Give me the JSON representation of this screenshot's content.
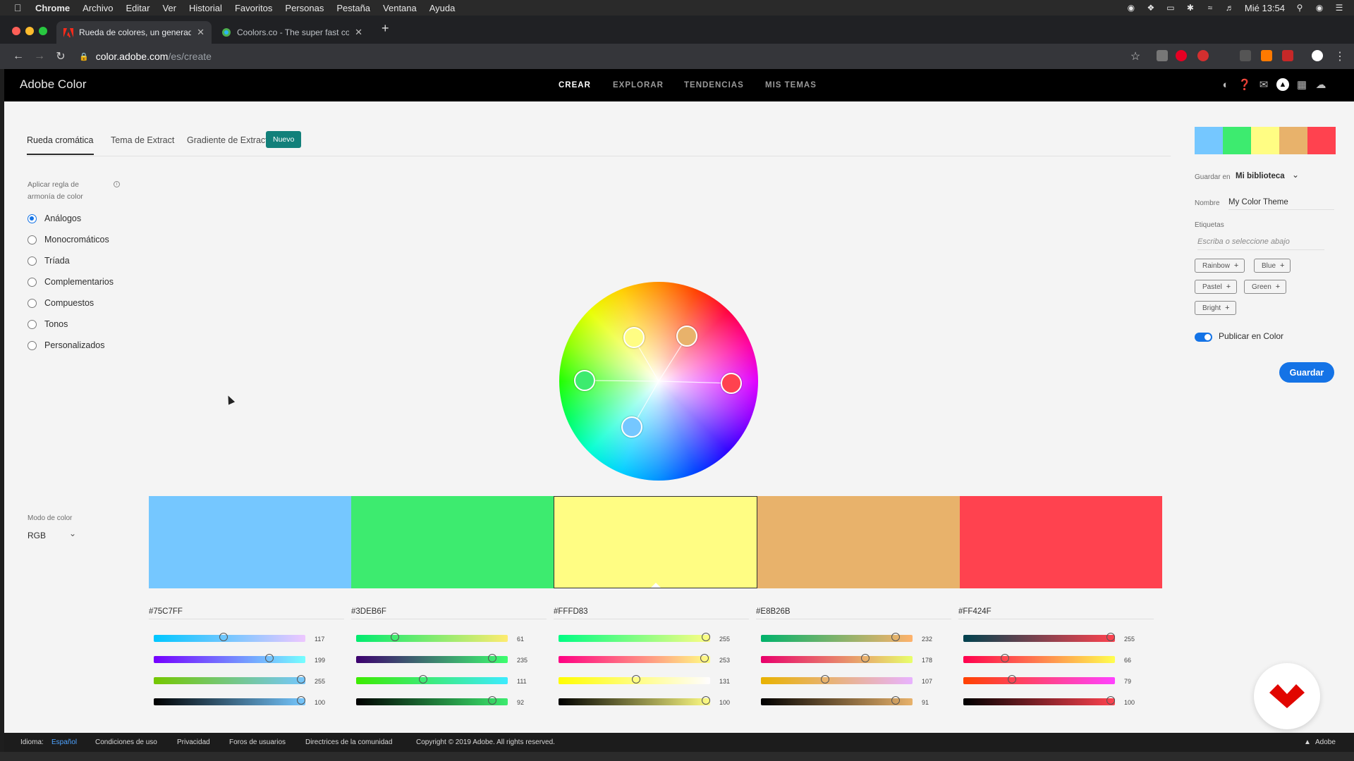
{
  "os_menubar": {
    "app": "Chrome",
    "items": [
      "Archivo",
      "Editar",
      "Ver",
      "Historial",
      "Favoritos",
      "Personas",
      "Pestaña",
      "Ventana",
      "Ayuda"
    ],
    "clock": "Mié 13:54"
  },
  "browser": {
    "tabs": [
      {
        "title": "Rueda de colores, un generador",
        "active": true
      },
      {
        "title": "Coolors.co - The super fast co",
        "active": false
      }
    ],
    "url_host": "color.adobe.com",
    "url_path": "/es/create"
  },
  "app": {
    "logo": "Adobe Color",
    "nav": [
      "CREAR",
      "EXPLORAR",
      "TENDENCIAS",
      "MIS TEMAS"
    ]
  },
  "mode_tabs": {
    "items": [
      "Rueda cromática",
      "Tema de Extract",
      "Gradiente de Extract"
    ],
    "badge": "Nuevo"
  },
  "harmony": {
    "label": "Aplicar regla de armonía de color",
    "options": [
      "Análogos",
      "Monocromáticos",
      "Tríada",
      "Complementarios",
      "Compuestos",
      "Tonos",
      "Personalizados"
    ],
    "selected": "Análogos"
  },
  "color_mode": {
    "label": "Modo de color",
    "value": "RGB"
  },
  "palette": [
    {
      "hex": "#75C7FF",
      "values": [
        "117",
        "199",
        "255",
        "100"
      ],
      "levels": [
        0.46,
        0.78,
        1.0,
        1.0
      ]
    },
    {
      "hex": "#3DEB6F",
      "values": [
        "61",
        "235",
        "111",
        "92"
      ],
      "levels": [
        0.24,
        0.92,
        0.44,
        0.92
      ]
    },
    {
      "hex": "#FFFD83",
      "values": [
        "255",
        "253",
        "131",
        "100"
      ],
      "levels": [
        1.0,
        0.99,
        0.51,
        1.0
      ]
    },
    {
      "hex": "#E8B26B",
      "values": [
        "232",
        "178",
        "107",
        "91"
      ],
      "levels": [
        0.91,
        0.7,
        0.42,
        0.91
      ]
    },
    {
      "hex": "#FF424F",
      "values": [
        "255",
        "66",
        "79",
        "100"
      ],
      "levels": [
        1.0,
        0.26,
        0.31,
        1.0
      ]
    }
  ],
  "side": {
    "save_in_label": "Guardar en",
    "library": "Mi biblioteca",
    "name_label": "Nombre",
    "name_value": "My Color Theme",
    "tags_label": "Etiquetas",
    "tags_placeholder": "Escriba o seleccione abajo",
    "tags": [
      "Rainbow",
      "Blue",
      "Pastel",
      "Green",
      "Bright"
    ],
    "publish_label": "Publicar en Color",
    "save_button": "Guardar"
  },
  "footer": {
    "lang_label": "Idioma:",
    "lang_value": "Español",
    "links": [
      "Condiciones de uso",
      "Privacidad",
      "Foros de usuarios",
      "Directrices de la comunidad"
    ],
    "copyright": "Copyright © 2019 Adobe. All rights reserved.",
    "brand": "Adobe"
  }
}
